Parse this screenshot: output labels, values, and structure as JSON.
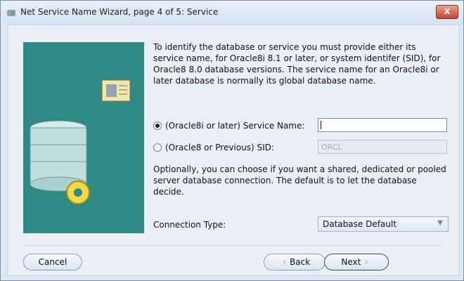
{
  "window": {
    "title": "Net Service Name Wizard, page 4 of 5: Service",
    "close_label": "X"
  },
  "intro_text": "To identify the database or service you must provide either its service name, for Oracle8i 8.1 or later, or system identifer (SID), for Oracle8 8.0 database versions. The service name for an Oracle8i or later database is normally its global database name.",
  "options": {
    "service_name": {
      "label": "(Oracle8i or later)  Service Name:",
      "value": "",
      "selected": true
    },
    "sid": {
      "label": "(Oracle8 or Previous) SID:",
      "value": "ORCL",
      "selected": false
    }
  },
  "connection_text": "Optionally, you can choose if you want a shared, dedicated or pooled server database connection. The default is to let the database decide.",
  "connection_type": {
    "label": "Connection Type:",
    "value": "Database Default"
  },
  "buttons": {
    "cancel": "Cancel",
    "back": "Back",
    "next": "Next"
  }
}
